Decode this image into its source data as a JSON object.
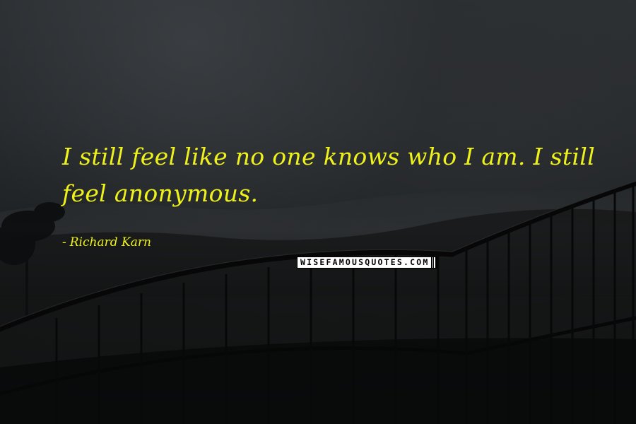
{
  "quote": {
    "text": "I still feel like no one knows who I am. I still feel anonymous.",
    "author": "Richard Karn",
    "dash": "-"
  },
  "brand": {
    "text": "WISEFAMOUSQUOTES.COM"
  },
  "colors": {
    "text": "#eef21a",
    "background": "#1a1c1e"
  },
  "background": {
    "description_icon": "night-city-railing-image"
  }
}
